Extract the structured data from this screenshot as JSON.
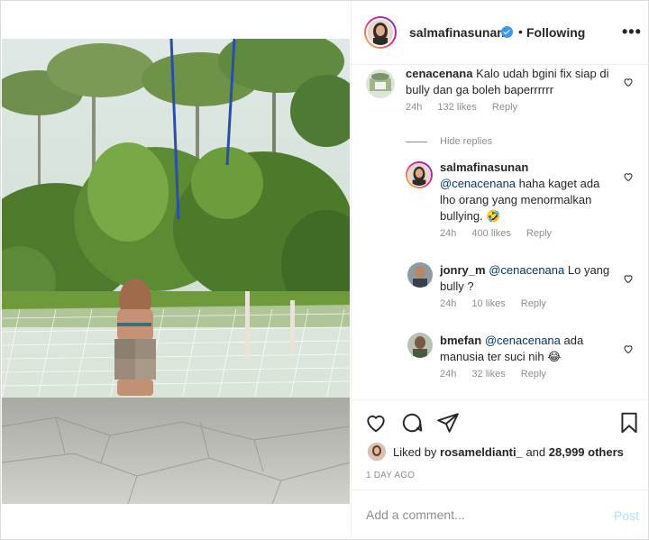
{
  "post": {
    "author": "salmafinasunan",
    "verified": true,
    "separator": "•",
    "follow_status": "Following",
    "more": "•••"
  },
  "comments": [
    {
      "user": "cenacenana",
      "mention": "",
      "text": "Kalo udah bgini fix siap di bully dan ga boleh baperrrrrr",
      "time": "24h",
      "likes": "132 likes",
      "reply": "Reply"
    }
  ],
  "hide_replies": "Hide replies",
  "replies": [
    {
      "user": "salmafinasunan",
      "mention": "@cenacenana",
      "text": "haha kaget ada lho orang yang menormalkan bullying. 🤣",
      "time": "24h",
      "likes": "400 likes",
      "reply": "Reply"
    },
    {
      "user": "jonry_m",
      "mention": "@cenacenana",
      "text": "Lo yang bully ?",
      "time": "24h",
      "likes": "10 likes",
      "reply": "Reply"
    },
    {
      "user": "bmefan",
      "mention": "@cenacenana",
      "text": "ada manusia ter suci nih 😂",
      "time": "24h",
      "likes": "32 likes",
      "reply": "Reply"
    }
  ],
  "actions": {
    "liked_by_prefix": "Liked by",
    "liked_by_user": "rosameldianti_",
    "liked_by_suffix": "and",
    "others": "28,999 others",
    "time_ago": "1 DAY AGO"
  },
  "add_comment": {
    "placeholder": "Add a comment...",
    "post_label": "Post"
  },
  "icons": {
    "like": "heart-icon",
    "comment": "comment-icon",
    "share": "share-icon",
    "save": "bookmark-icon"
  },
  "colors": {
    "verified": "#3897f0",
    "mention": "#00376b",
    "secondary_text": "#8e8e8e",
    "post_disabled": "#b2dffc"
  }
}
